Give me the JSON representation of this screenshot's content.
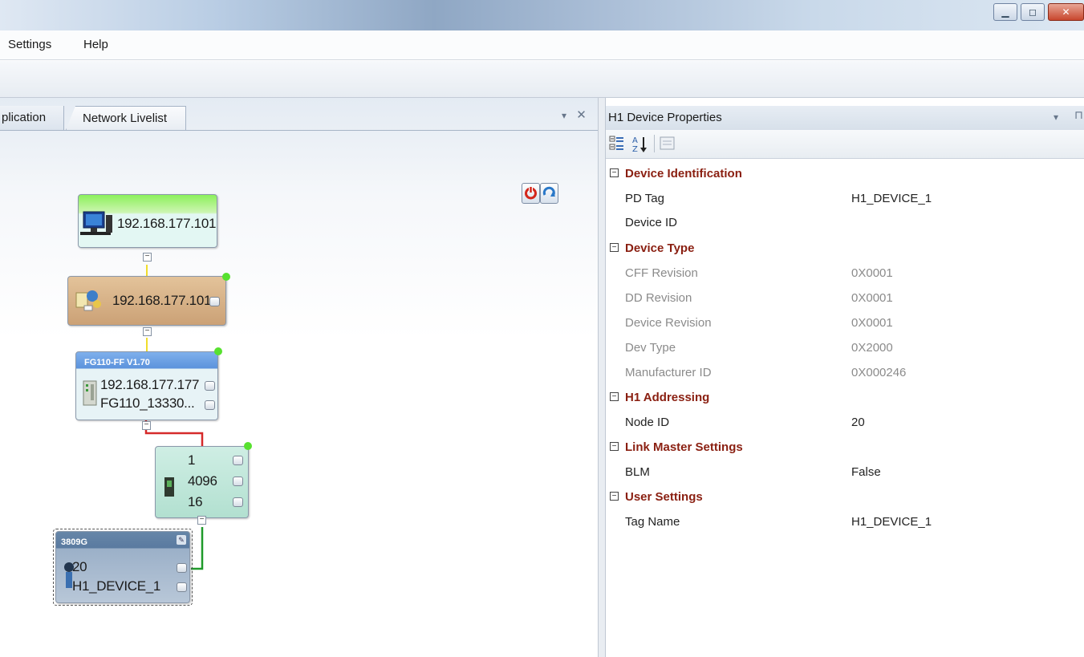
{
  "window": {
    "title": "",
    "controls": [
      "minimize",
      "maximize",
      "close"
    ]
  },
  "menu": {
    "settings": "Settings",
    "help": "Help"
  },
  "left_panel": {
    "tabs": [
      {
        "label": "plication"
      },
      {
        "label": "Network Livelist"
      }
    ],
    "controls": {
      "pin": "▾",
      "close": "✕"
    },
    "nodes": {
      "pc": {
        "ip": "192.168.177.101"
      },
      "gateway": {
        "ip": "192.168.177.101"
      },
      "fg110": {
        "header": "FG110-FF V1.70",
        "ip": "192.168.177.177",
        "name": "FG110_13330..."
      },
      "link": {
        "v1": "1",
        "v2": "4096",
        "v3": "16"
      },
      "device": {
        "header": "3809G",
        "node_id": "20",
        "tag": "H1_DEVICE_1"
      }
    }
  },
  "right_panel": {
    "title": "H1 Device Properties",
    "controls": {
      "dropdown": "▾",
      "pin": "⊓"
    },
    "categories": [
      {
        "name": "Device Identification",
        "props": [
          {
            "name": "PD Tag",
            "value": "H1_DEVICE_1",
            "readonly": false
          },
          {
            "name": "Device ID",
            "value": "",
            "readonly": false
          }
        ]
      },
      {
        "name": "Device Type",
        "props": [
          {
            "name": "CFF Revision",
            "value": "0X0001",
            "readonly": true
          },
          {
            "name": "DD Revision",
            "value": "0X0001",
            "readonly": true
          },
          {
            "name": "Device Revision",
            "value": "0X0001",
            "readonly": true
          },
          {
            "name": "Dev Type",
            "value": "0X2000",
            "readonly": true
          },
          {
            "name": "Manufacturer ID",
            "value": "0X000246",
            "readonly": true
          }
        ]
      },
      {
        "name": "H1 Addressing",
        "props": [
          {
            "name": "Node ID",
            "value": "20",
            "readonly": false
          }
        ]
      },
      {
        "name": "Link Master Settings",
        "props": [
          {
            "name": "BLM",
            "value": "False",
            "readonly": false
          }
        ]
      },
      {
        "name": "User Settings",
        "props": [
          {
            "name": "Tag Name",
            "value": "H1_DEVICE_1",
            "readonly": false
          }
        ]
      }
    ]
  },
  "colors": {
    "category": "#8a1f11",
    "readonly": "#8b8b8b",
    "link_red": "#d62a2a",
    "link_green": "#1f9a2a",
    "link_yellow": "#f0dd2c",
    "status_green": "#57e12f"
  }
}
